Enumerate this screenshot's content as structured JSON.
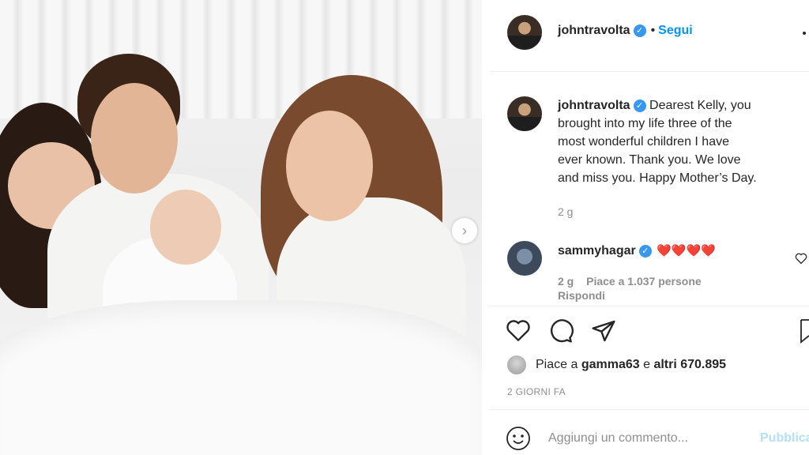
{
  "header": {
    "username": "johntravolta",
    "separator": "•",
    "follow_label": "Segui",
    "more_icon": "more-icon"
  },
  "caption": {
    "username": "johntravolta",
    "text_lines": [
      "Dearest Kelly, you",
      "brought into my life three of the",
      "most wonderful children I have",
      "ever known. Thank you. We love",
      "and miss you. Happy Mother’s Day."
    ],
    "age": "2 g"
  },
  "comment": {
    "username": "sammyhagar",
    "hearts": "❤️❤️❤️❤️",
    "age": "2 g",
    "likes": "Piace a 1.037 persone",
    "reply_label": "Rispondi"
  },
  "actions": {
    "like_icon": "heart-icon",
    "comment_icon": "comment-icon",
    "share_icon": "share-icon",
    "save_icon": "bookmark-icon"
  },
  "likes": {
    "prefix": "Piace a ",
    "user": "gamma63",
    "middle": " e ",
    "others": "altri 670.895"
  },
  "timestamp": "2 GIORNI FA",
  "composer": {
    "placeholder": "Aggiungi un commento...",
    "post_label": "Pubblica"
  },
  "colors": {
    "accent": "#0095f6",
    "verified": "#3897f0",
    "heart": "#ed4956"
  }
}
